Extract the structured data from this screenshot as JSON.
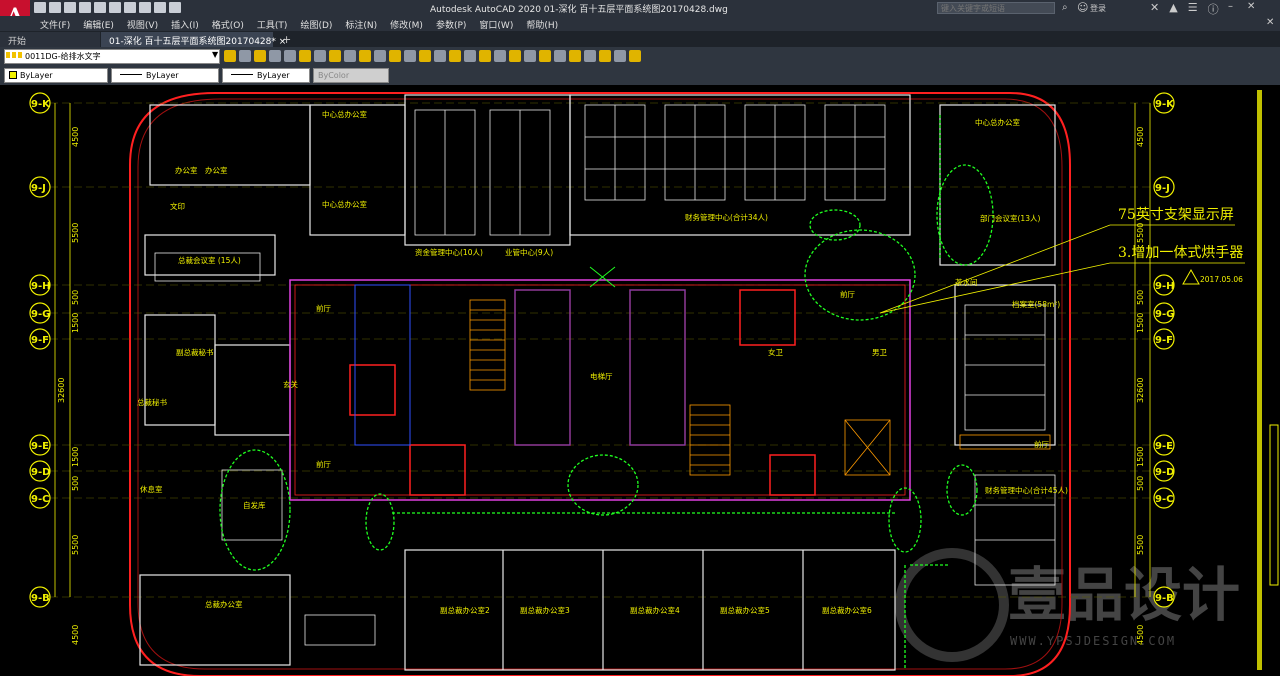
{
  "app": {
    "logo_letter": "A",
    "window_title": "Autodesk AutoCAD 2020   01-深化 百十五层平面系统图20170428.dwg",
    "search_placeholder": "键入关键字或短语",
    "login_label": "登录"
  },
  "menu": {
    "items": [
      "文件(F)",
      "编辑(E)",
      "视图(V)",
      "插入(I)",
      "格式(O)",
      "工具(T)",
      "绘图(D)",
      "标注(N)",
      "修改(M)",
      "参数(P)",
      "窗口(W)",
      "帮助(H)"
    ]
  },
  "tabs": [
    {
      "label": "开始"
    },
    {
      "label": "01-深化 百十五层平面系统图20170428*  ×"
    }
  ],
  "toolbar": {
    "layer_name": "0011DG-给排水文字"
  },
  "properties": {
    "color": "ByLayer",
    "linetype": "ByLayer",
    "lineweight": "ByLayer",
    "plotstyle": "ByColor"
  },
  "grid": {
    "left_axes": [
      "9-K",
      "9-J",
      "9-H",
      "9-G",
      "9-F",
      "9-E",
      "9-D",
      "9-C",
      "9-B"
    ],
    "right_axes": [
      "9-K",
      "9-J",
      "9-H",
      "9-G",
      "9-F",
      "9-E",
      "9-D",
      "9-C",
      "9-B"
    ],
    "left_dims": [
      "4500",
      "5500",
      "500",
      "1500",
      "32600",
      "1500",
      "500",
      "5500",
      "4500"
    ],
    "right_dims": [
      "4500",
      "5500",
      "500",
      "1500",
      "32600",
      "1500",
      "500",
      "5500",
      "4500"
    ]
  },
  "rooms": [
    "总裁办公室",
    "办公室",
    "中心总办公室",
    "中心总办公室",
    "资金管理中心(10人)",
    "业管中心(9人)",
    "财务管理中心(合计34人)",
    "中心总办公室",
    "部门会议室(13人)",
    "总裁会议室 (15人)",
    "前厅",
    "玄关",
    "电梯厅",
    "女卫",
    "男卫",
    "档案室(58m²)",
    "茶水间",
    "副总裁秘书",
    "总裁秘书",
    "前厅",
    "自发库",
    "财务管理中心(合计45人)",
    "总裁办公室",
    "副总裁办公室2",
    "副总裁办公室3",
    "副总裁办公室4",
    "副总裁办公室5",
    "副总裁办公室6",
    "前厅",
    "前厅",
    "休息室",
    "文印"
  ],
  "annotations": {
    "note_1": "75英寸支架显示屏",
    "note_2": "3.增加一体式烘手器",
    "revision": "2017.05.06"
  },
  "watermark": {
    "brand": "壹品设计",
    "url": "WWW.YPSJDESIGN.COM"
  },
  "colors": {
    "background": "#000000",
    "wall_red": "#ff2020",
    "annotation_yellow": "#f0f000",
    "furniture_white": "#e8e8e8",
    "green_boundary": "#20ff20",
    "magenta": "#e040e0",
    "blue": "#3050ff",
    "orange": "#ff9a00"
  }
}
